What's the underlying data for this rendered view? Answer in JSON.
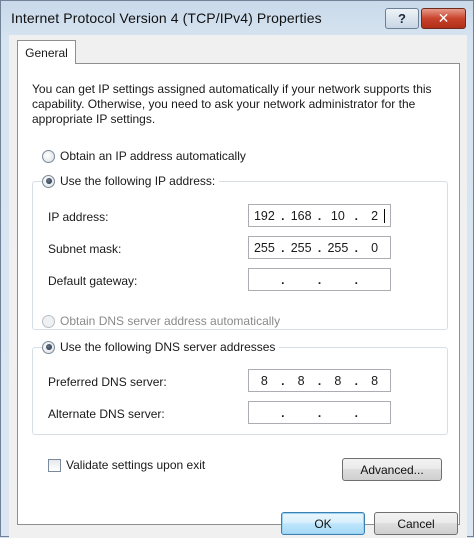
{
  "window": {
    "title": "Internet Protocol Version 4 (TCP/IPv4) Properties",
    "help_label": "?",
    "close_label": "✕"
  },
  "tabs": [
    {
      "label": "General",
      "selected": true
    }
  ],
  "description": "You can get IP settings assigned automatically if your network supports this capability. Otherwise, you need to ask your network administrator for the appropriate IP settings.",
  "ip": {
    "auto_label": "Obtain an IP address automatically",
    "manual_label": "Use the following IP address:",
    "selected": "manual",
    "address": {
      "label": "IP address:",
      "octets": [
        "192",
        "168",
        "10",
        "2"
      ]
    },
    "subnet": {
      "label": "Subnet mask:",
      "octets": [
        "255",
        "255",
        "255",
        "0"
      ]
    },
    "gateway": {
      "label": "Default gateway:",
      "octets": [
        "",
        "",
        "",
        ""
      ]
    }
  },
  "dns": {
    "auto_label": "Obtain DNS server address automatically",
    "manual_label": "Use the following DNS server addresses",
    "selected": "manual",
    "preferred": {
      "label": "Preferred DNS server:",
      "octets": [
        "8",
        "8",
        "8",
        "8"
      ]
    },
    "alternate": {
      "label": "Alternate DNS server:",
      "octets": [
        "",
        "",
        "",
        ""
      ]
    }
  },
  "validate": {
    "label": "Validate settings upon exit",
    "checked": false
  },
  "buttons": {
    "advanced": "Advanced...",
    "ok": "OK",
    "cancel": "Cancel"
  },
  "colors": {
    "titlebar": "#c9d9ea",
    "close": "#c8432c",
    "default_button": "#bee6fd"
  }
}
